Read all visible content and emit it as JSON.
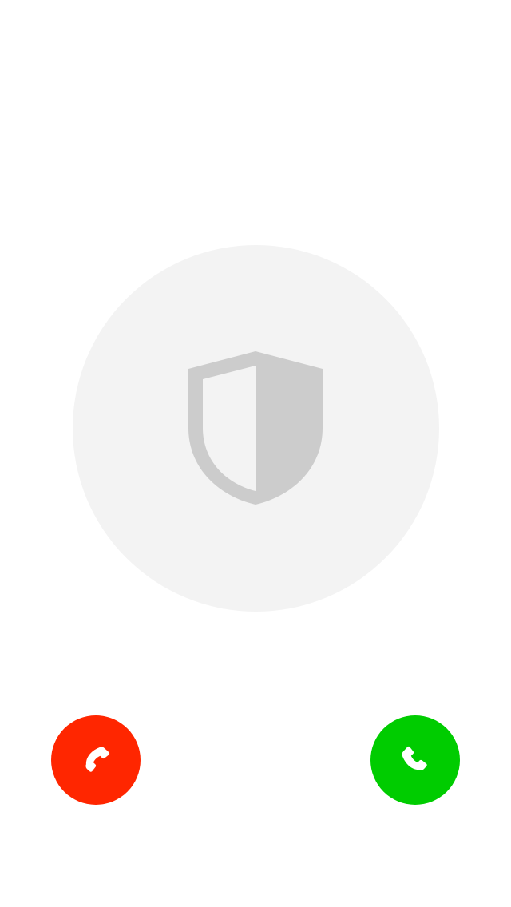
{
  "screen": {
    "background": "#ffffff"
  },
  "avatar": {
    "icon": "shield-icon",
    "circle_color": "#f3f3f3",
    "icon_color": "#cccccc"
  },
  "actions": {
    "decline": {
      "icon": "phone-hangup-icon",
      "color": "#ff2600"
    },
    "accept": {
      "icon": "phone-icon",
      "color": "#00cc00"
    }
  }
}
